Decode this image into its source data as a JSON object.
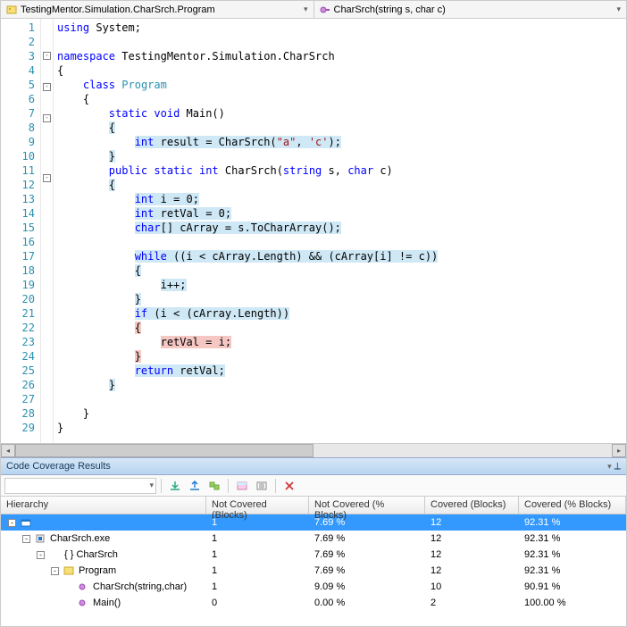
{
  "nav": {
    "class_path": "TestingMentor.Simulation.CharSrch.Program",
    "member": "CharSrch(string s, char c)"
  },
  "code_lines": [
    {
      "n": 1,
      "fold": "",
      "html": "<span class='kw'>using</span> System;"
    },
    {
      "n": 2,
      "fold": "",
      "html": ""
    },
    {
      "n": 3,
      "fold": "box",
      "html": "<span class='kw'>namespace</span> TestingMentor.Simulation.CharSrch"
    },
    {
      "n": 4,
      "fold": "",
      "html": "{"
    },
    {
      "n": 5,
      "fold": "box",
      "html": "    <span class='kw'>class</span> <span class='typ'>Program</span>"
    },
    {
      "n": 6,
      "fold": "",
      "html": "    {"
    },
    {
      "n": 7,
      "fold": "box",
      "html": "        <span class='kw'>static</span> <span class='kw'>void</span> Main()"
    },
    {
      "n": 8,
      "fold": "",
      "html": "        <span class='cov'>{</span>"
    },
    {
      "n": 9,
      "fold": "",
      "html": "            <span class='cov'><span class='kw'>int</span> result = CharSrch(<span class='str'>\"a\"</span>, <span class='str'>'c'</span>);</span>"
    },
    {
      "n": 10,
      "fold": "",
      "html": "        <span class='cov'>}</span>"
    },
    {
      "n": 11,
      "fold": "box",
      "html": "        <span class='kw'>public</span> <span class='kw'>static</span> <span class='kw'>int</span> CharSrch(<span class='kw'>string</span> s, <span class='kw'>char</span> c)"
    },
    {
      "n": 12,
      "fold": "",
      "html": "        <span class='cov'>{</span>"
    },
    {
      "n": 13,
      "fold": "",
      "html": "            <span class='cov'><span class='kw'>int</span> i = 0;</span>"
    },
    {
      "n": 14,
      "fold": "",
      "html": "            <span class='cov'><span class='kw'>int</span> retVal = 0;</span>"
    },
    {
      "n": 15,
      "fold": "",
      "html": "            <span class='cov'><span class='kw'>char</span>[] cArray = s.ToCharArray();</span>"
    },
    {
      "n": 16,
      "fold": "",
      "html": ""
    },
    {
      "n": 17,
      "fold": "",
      "html": "            <span class='cov'><span class='kw'>while</span> ((i &lt; cArray.Length) &amp;&amp; (cArray[i] != c))</span>"
    },
    {
      "n": 18,
      "fold": "",
      "html": "            <span class='cov'>{</span>"
    },
    {
      "n": 19,
      "fold": "",
      "html": "                <span class='cov'>i++;</span>"
    },
    {
      "n": 20,
      "fold": "",
      "html": "            <span class='cov'>}</span>"
    },
    {
      "n": 21,
      "fold": "",
      "html": "            <span class='cov'><span class='kw'>if</span> (i &lt; (cArray.Length))</span>"
    },
    {
      "n": 22,
      "fold": "",
      "html": "            <span class='uncov'>{</span>"
    },
    {
      "n": 23,
      "fold": "",
      "html": "                <span class='uncov'>retVal = i;</span>"
    },
    {
      "n": 24,
      "fold": "",
      "html": "            <span class='uncov'>}</span>"
    },
    {
      "n": 25,
      "fold": "",
      "html": "            <span class='cov'><span class='kw'>return</span> retVal;</span>"
    },
    {
      "n": 26,
      "fold": "",
      "html": "        <span class='cov'>}</span>"
    },
    {
      "n": 27,
      "fold": "",
      "html": ""
    },
    {
      "n": 28,
      "fold": "",
      "html": "    }"
    },
    {
      "n": 29,
      "fold": "",
      "html": "}"
    }
  ],
  "panel": {
    "title": "Code Coverage Results"
  },
  "grid": {
    "headers": {
      "h": "Hierarchy",
      "a": "Not Covered (Blocks)",
      "b": "Not Covered (% Blocks)",
      "c": "Covered (Blocks)",
      "d": "Covered (% Blocks)"
    },
    "rows": [
      {
        "indent": 0,
        "exp": "-",
        "icon": "root",
        "label": "",
        "a": "1",
        "b": "7.69 %",
        "c": "12",
        "d": "92.31 %",
        "sel": true
      },
      {
        "indent": 1,
        "exp": "-",
        "icon": "exe",
        "label": "CharSrch.exe",
        "a": "1",
        "b": "7.69 %",
        "c": "12",
        "d": "92.31 %"
      },
      {
        "indent": 2,
        "exp": "-",
        "icon": "ns",
        "label": "{ } CharSrch",
        "a": "1",
        "b": "7.69 %",
        "c": "12",
        "d": "92.31 %"
      },
      {
        "indent": 3,
        "exp": "-",
        "icon": "class",
        "label": "Program",
        "a": "1",
        "b": "7.69 %",
        "c": "12",
        "d": "92.31 %"
      },
      {
        "indent": 4,
        "exp": "",
        "icon": "method",
        "label": "CharSrch(string,char)",
        "a": "1",
        "b": "9.09 %",
        "c": "10",
        "d": "90.91 %"
      },
      {
        "indent": 4,
        "exp": "",
        "icon": "method",
        "label": "Main()",
        "a": "0",
        "b": "0.00 %",
        "c": "2",
        "d": "100.00 %"
      }
    ]
  }
}
